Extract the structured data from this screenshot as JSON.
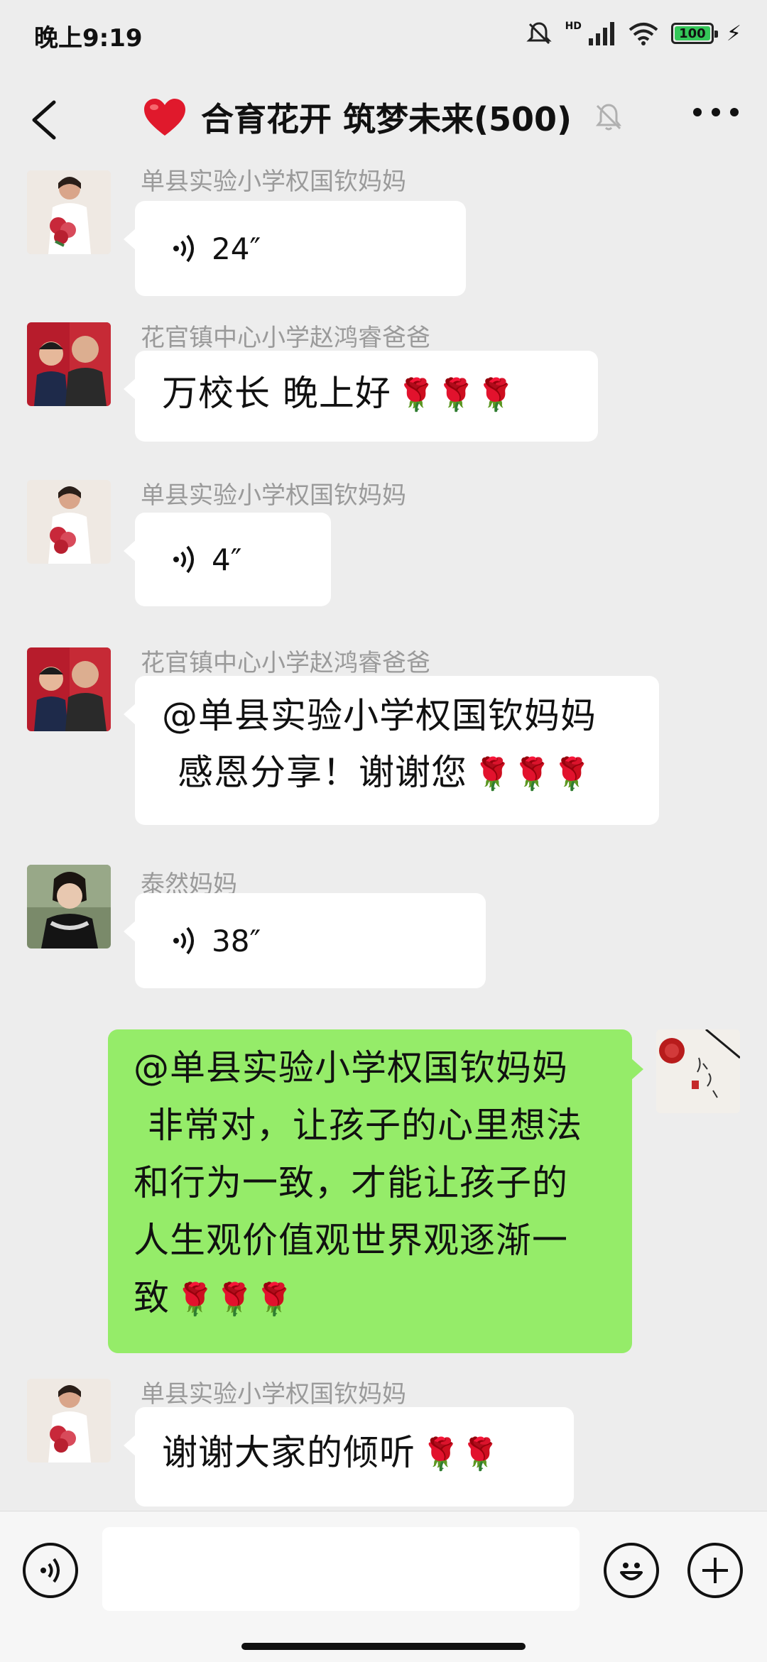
{
  "status_bar": {
    "time": "晚上9:19",
    "battery": "100",
    "network": "HD"
  },
  "header": {
    "title": "合育花开 筑梦未来(500)"
  },
  "messages": [
    {
      "sender": "单县实验小学权国钦妈妈",
      "type": "voice",
      "duration": "24″"
    },
    {
      "sender": "花官镇中心小学赵鸿睿爸爸",
      "type": "text",
      "text": "万校长 晚上好",
      "roses": "🌹🌹🌹"
    },
    {
      "sender": "单县实验小学权国钦妈妈",
      "type": "voice",
      "duration": "4″"
    },
    {
      "sender": "花官镇中心小学赵鸿睿爸爸",
      "type": "text",
      "line1": "@单县实验小学权国钦妈妈",
      "line2": "感恩分享！谢谢您",
      "roses": "🌹🌹🌹"
    },
    {
      "sender": "泰然妈妈",
      "type": "voice",
      "duration": "38″"
    },
    {
      "sender": "",
      "type": "text",
      "own": true,
      "line1": "@单县实验小学权国钦妈妈",
      "line2": "非常对，让孩子的心里想法",
      "line3": "和行为一致，才能让孩子的",
      "line4": "人生观价值观世界观逐渐一",
      "line5": "致",
      "roses": "🌹🌹🌹"
    },
    {
      "sender": "单县实验小学权国钦妈妈",
      "type": "text",
      "text": "谢谢大家的倾听",
      "roses": "🌹🌹"
    }
  ],
  "colors": {
    "self_bubble": "#95ec69",
    "other_bubble": "#ffffff",
    "background": "#ededed"
  },
  "icons": [
    "back-icon",
    "heart-icon",
    "mute-bell-icon",
    "more-icon",
    "voice-input-icon",
    "emoji-icon",
    "plus-icon"
  ]
}
